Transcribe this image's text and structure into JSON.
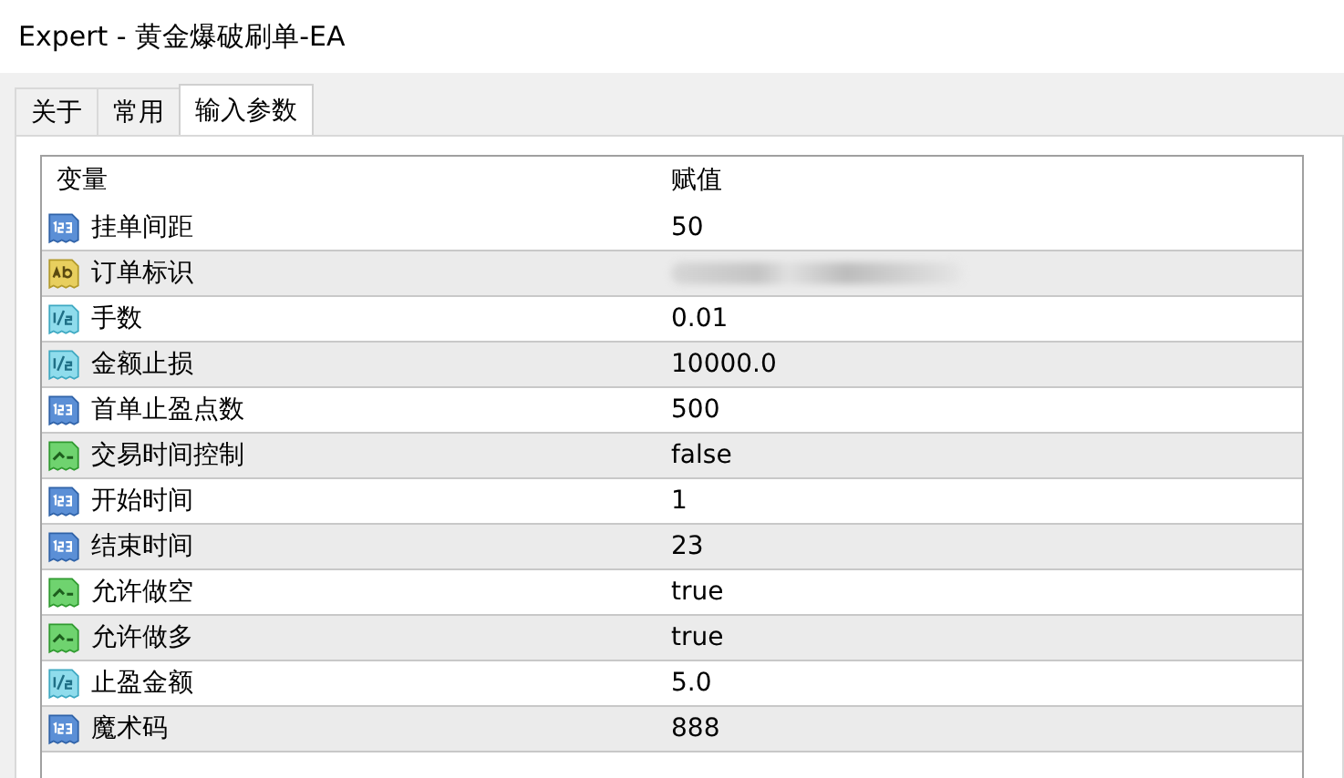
{
  "window": {
    "title": "Expert - 黄金爆破刷单-EA"
  },
  "tabs": [
    {
      "label": "关于",
      "selected": false
    },
    {
      "label": "常用",
      "selected": false
    },
    {
      "label": "输入参数",
      "selected": true
    }
  ],
  "table": {
    "columns": [
      "变量",
      "赋值"
    ],
    "rows": [
      {
        "kind": "int",
        "name": "挂单间距",
        "value": "50"
      },
      {
        "kind": "string",
        "name": "订单标识",
        "redacted": true
      },
      {
        "kind": "double",
        "name": "手数",
        "value": "0.01"
      },
      {
        "kind": "double",
        "name": "金额止损",
        "value": "10000.0"
      },
      {
        "kind": "int",
        "name": "首单止盈点数",
        "value": "500"
      },
      {
        "kind": "bool",
        "name": "交易时间控制",
        "value": "false"
      },
      {
        "kind": "int",
        "name": "开始时间",
        "value": "1"
      },
      {
        "kind": "int",
        "name": "结束时间",
        "value": "23"
      },
      {
        "kind": "bool",
        "name": "允许做空",
        "value": "true"
      },
      {
        "kind": "bool",
        "name": "允许做多",
        "value": "true"
      },
      {
        "kind": "double",
        "name": "止盈金额",
        "value": "5.0"
      },
      {
        "kind": "int",
        "name": "魔术码",
        "value": "888"
      }
    ]
  }
}
